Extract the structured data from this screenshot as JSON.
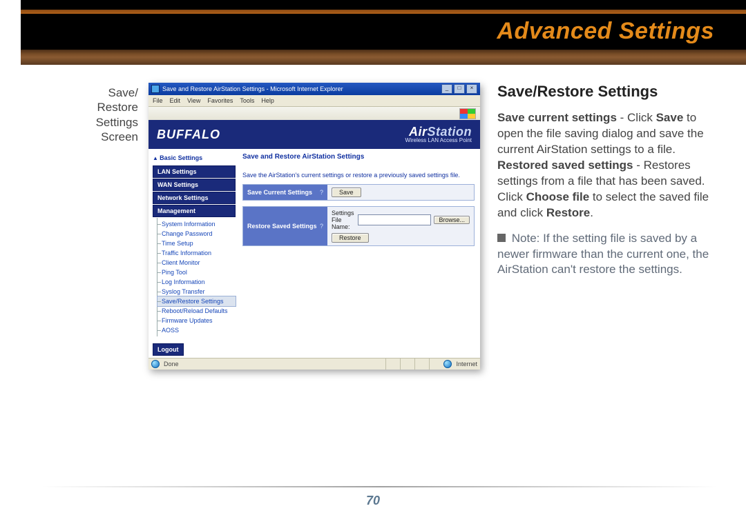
{
  "page": {
    "heading": "Advanced Settings",
    "number": "70",
    "side_caption_l1": "Save/",
    "side_caption_l2": "Restore",
    "side_caption_l3": "Settings",
    "side_caption_l4": "Screen"
  },
  "right": {
    "title": "Save/Restore Settings",
    "p1_a": "Save current settings",
    "p1_b": " - Click ",
    "p1_c": "Save",
    "p1_d": " to open the file saving dialog and save the current AirStation settings to a file.",
    "p2_a": "Restored saved settings",
    "p2_b": " - Restores settings from a file that has been saved. Click ",
    "p2_c": "Choose file",
    "p2_d": " to select the saved file and click ",
    "p2_e": "Restore",
    "p2_f": ".",
    "note_label": "Note:",
    "note_text": " If the setting file is saved by a newer firmware than the current one, the AirStation can't restore the settings."
  },
  "shot": {
    "window_title": "Save and Restore AirStation Settings - Microsoft Internet Explorer",
    "menu": {
      "file": "File",
      "edit": "Edit",
      "view": "View",
      "favorites": "Favorites",
      "tools": "Tools",
      "help": "Help"
    },
    "brand": "BUFFALO",
    "product_air": "Air",
    "product_station": "Station",
    "product_sub": "Wireless LAN Access Point",
    "nav": {
      "crumb": "Basic Settings",
      "items": [
        "LAN Settings",
        "WAN Settings",
        "Network Settings",
        "Management"
      ],
      "sub": [
        "System Information",
        "Change Password",
        "Time Setup",
        "Traffic Information",
        "Client Monitor",
        "Ping Tool",
        "Log Information",
        "Syslog Transfer",
        "Save/Restore Settings",
        "Reboot/Reload Defaults",
        "Firmware Updates",
        "AOSS"
      ],
      "logout": "Logout"
    },
    "main": {
      "title": "Save and Restore AirStation Settings",
      "instr": "Save the AirStation's current settings or restore a previously saved settings file.",
      "row1_label": "Save Current Settings",
      "row1_btn": "Save",
      "row2_label": "Restore Saved Settings",
      "row2_file_label": "Settings File Name:",
      "row2_browse": "Browse...",
      "row2_btn": "Restore",
      "q": "?"
    },
    "status": {
      "done": "Done",
      "internet": "Internet"
    }
  }
}
